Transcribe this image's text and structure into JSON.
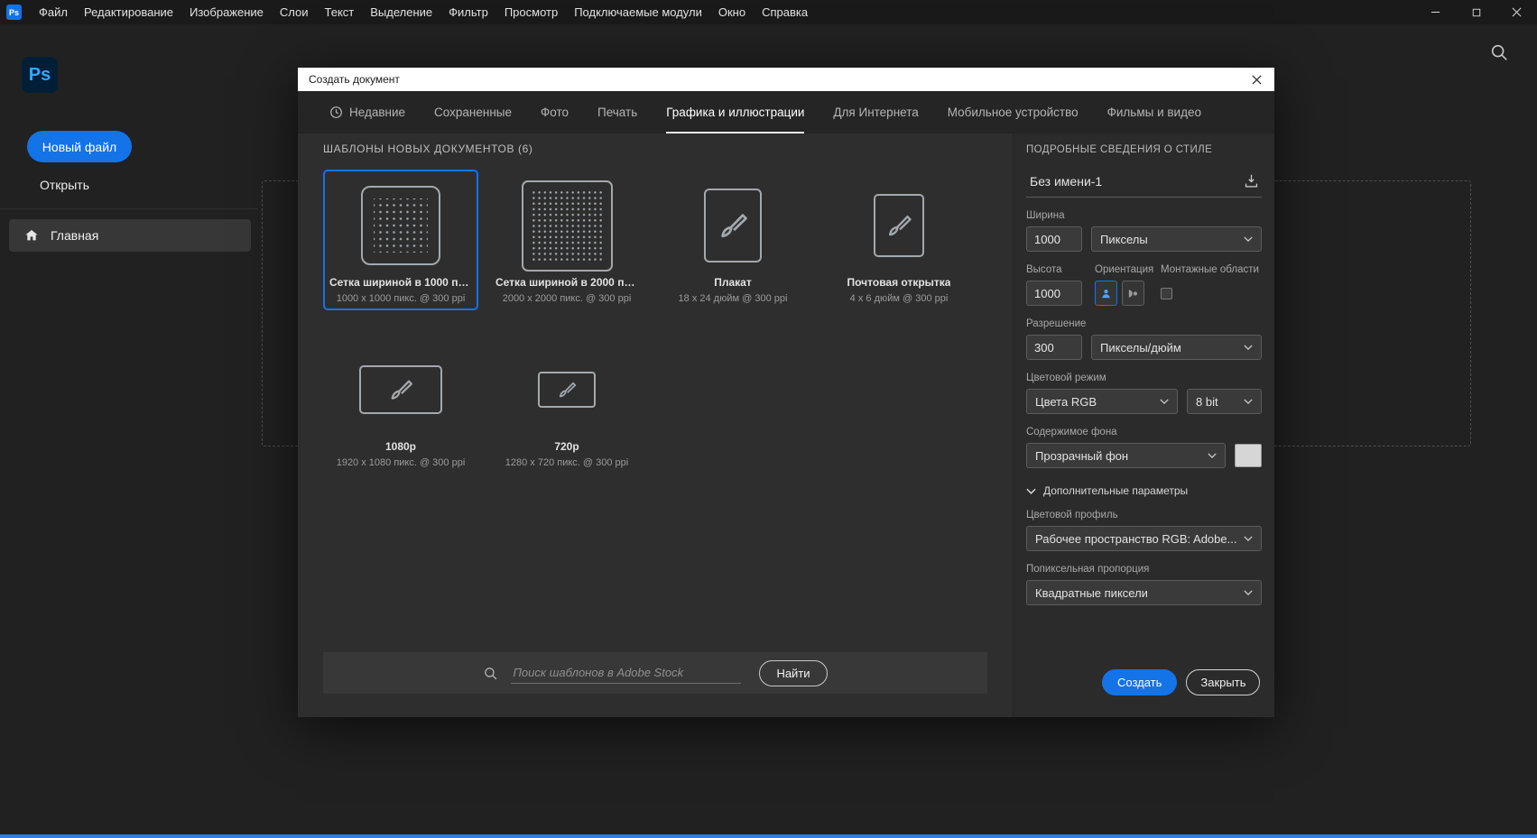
{
  "colors": {
    "accent": "#1473e6",
    "logo_bg": "#001e36",
    "logo_text": "#31a8ff"
  },
  "titlebar": {
    "logo": "Ps",
    "menus": [
      "Файл",
      "Редактирование",
      "Изображение",
      "Слои",
      "Текст",
      "Выделение",
      "Фильтр",
      "Просмотр",
      "Подключаемые модули",
      "Окно",
      "Справка"
    ]
  },
  "home": {
    "logo": "Ps",
    "new_file": "Новый файл",
    "open": "Открыть",
    "home_item": "Главная"
  },
  "icons": {
    "titlebar": [
      "minimize-icon",
      "maximize-icon",
      "close-icon"
    ],
    "home": [
      "home-icon",
      "search-icon"
    ],
    "dialog": [
      "clock-icon",
      "close-icon",
      "magnifier-icon",
      "save-preset-icon",
      "chevron-down-icon",
      "portrait-orientation-icon",
      "landscape-orientation-icon",
      "brush-icon",
      "grid-icon"
    ]
  },
  "dialog": {
    "title": "Создать документ",
    "tabs": [
      "Недавние",
      "Сохраненные",
      "Фото",
      "Печать",
      "Графика и иллюстрации",
      "Для Интернета",
      "Мобильное устройство",
      "Фильмы и видео"
    ],
    "active_tab": "Графика и иллюстрации",
    "templates_header": "ШАБЛОНЫ НОВЫХ ДОКУМЕНТОВ (6)",
    "templates": [
      {
        "name": "Сетка шириной в 1000 пи...",
        "spec": "1000 x 1000 пикс. @ 300 ppi",
        "selected": true
      },
      {
        "name": "Сетка шириной в 2000 пи...",
        "spec": "2000 x 2000 пикс. @ 300 ppi",
        "selected": false
      },
      {
        "name": "Плакат",
        "spec": "18 x 24 дюйм @ 300 ppi",
        "selected": false
      },
      {
        "name": "Почтовая открытка",
        "spec": "4 x 6 дюйм @ 300 ppi",
        "selected": false
      },
      {
        "name": "1080p",
        "spec": "1920 x 1080 пикс. @ 300 ppi",
        "selected": false
      },
      {
        "name": "720p",
        "spec": "1280 x 720 пикс. @ 300 ppi",
        "selected": false
      }
    ],
    "search": {
      "placeholder": "Поиск шаблонов в Adobe Stock",
      "button": "Найти"
    },
    "panel": {
      "header": "ПОДРОБНЫЕ СВЕДЕНИЯ О СТИЛЕ",
      "doc_name": "Без имени-1",
      "width_label": "Ширина",
      "width_value": "1000",
      "width_unit": "Пикселы",
      "height_label": "Высота",
      "height_value": "1000",
      "orientation_label": "Ориентация",
      "artboards_label": "Монтажные области",
      "resolution_label": "Разрешение",
      "resolution_value": "300",
      "resolution_unit": "Пикселы/дюйм",
      "color_mode_label": "Цветовой режим",
      "color_mode_value": "Цвета RGB",
      "bit_depth_value": "8 bit",
      "background_label": "Содержимое фона",
      "background_value": "Прозрачный фон",
      "advanced_label": "Дополнительные параметры",
      "profile_label": "Цветовой профиль",
      "profile_value": "Рабочее пространство RGB: Adobe...",
      "aspect_label": "Попиксельная пропорция",
      "aspect_value": "Квадратные пиксели",
      "create_button": "Создать",
      "close_button": "Закрыть"
    }
  }
}
